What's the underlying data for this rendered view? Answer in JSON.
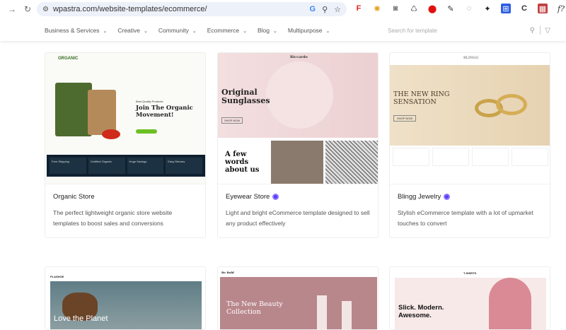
{
  "browser": {
    "url": "wpastra.com/website-templates/ecommerce/"
  },
  "nav": {
    "items": [
      "Business & Services",
      "Creative",
      "Community",
      "Ecommerce",
      "Blog",
      "Multipurpose"
    ],
    "search_placeholder": "Search for template"
  },
  "cards": [
    {
      "title": "Organic Store",
      "premium": false,
      "description": "The perfect lightweight organic store website templates to boost sales and conversions",
      "thumb": {
        "logo": "ORGANIC",
        "heading": "Join The Organic Movement!",
        "tagline": "Best Quality Products",
        "features": [
          "Free Shipping",
          "Certified Organic",
          "Huge Savings",
          "Easy Returns"
        ]
      }
    },
    {
      "title": "Eyewear Store",
      "premium": true,
      "description": "Light and bright eCommerce template designed to sell any product effectively",
      "thumb": {
        "logo": "Riccardo",
        "heading": "Original Sunglasses",
        "button": "SHOP NOW",
        "sub_heading": "A few words about us"
      }
    },
    {
      "title": "Blingg Jewelry",
      "premium": true,
      "description": "Stylish eCommerce template with a lot of upmarket touches to convert",
      "thumb": {
        "logo": "BLINGG",
        "heading": "THE NEW RING SENSATION",
        "button": "SHOP NOW"
      }
    },
    {
      "thumb": {
        "logo": "PLASHOE",
        "heading": "Love the Planet"
      }
    },
    {
      "thumb": {
        "logo": "Be Bold",
        "heading": "The New Beauty Collection"
      }
    },
    {
      "thumb": {
        "logo": "T-SHIRTS",
        "heading": "Slick. Modern. Awesome."
      }
    }
  ],
  "colors": {
    "premium_badge": "#5b3df5",
    "url_bar": "#edf1f9"
  }
}
